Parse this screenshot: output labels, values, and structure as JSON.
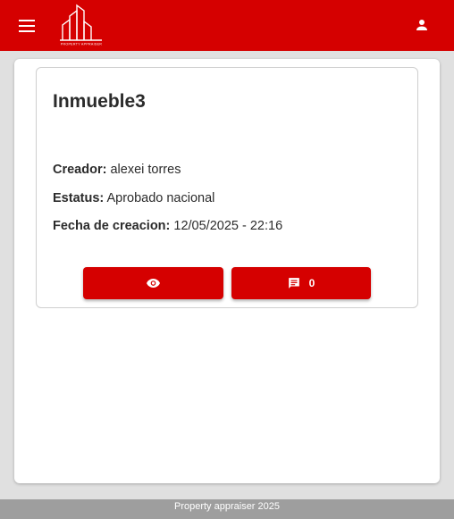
{
  "header": {
    "menu_icon": "menu-icon",
    "logo_text": "PROPERTY APPRAISER",
    "user_icon": "person-icon",
    "color": "#d50000"
  },
  "property_card": {
    "title": "Inmueble3",
    "creator_label": "Creador:",
    "creator_value": "alexei torres",
    "status_label": "Estatus:",
    "status_value": "Aprobado nacional",
    "date_label": "Fecha de creacion:",
    "date_value": "12/05/2025 - 22:16",
    "view_button_icon": "eye-icon",
    "comments_button_icon": "comment-icon",
    "comments_count": "0"
  },
  "footer": {
    "text": "Property appraiser 2025"
  }
}
